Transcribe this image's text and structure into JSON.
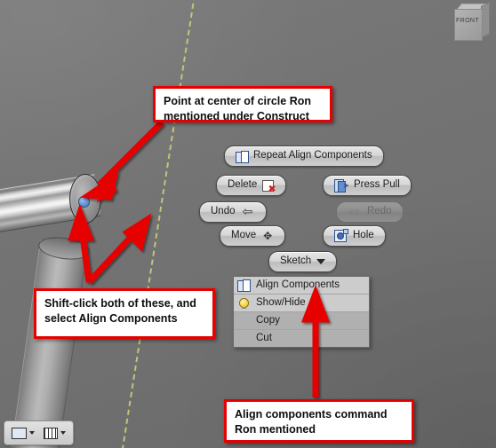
{
  "app": {
    "viewcube_label": "FRONT"
  },
  "marking_menu": {
    "buttons": [
      {
        "label": "Repeat Align Components",
        "icon": "align-components-icon",
        "enabled": true
      },
      {
        "label": "Delete",
        "icon": "delete-icon",
        "enabled": true
      },
      {
        "label": "Press Pull",
        "icon": "press-pull-icon",
        "enabled": true
      },
      {
        "label": "Undo",
        "icon": "undo-arrow-icon",
        "enabled": true
      },
      {
        "label": "Redo",
        "icon": "redo-arrow-icon",
        "enabled": false
      },
      {
        "label": "Move",
        "icon": "move-icon",
        "enabled": true
      },
      {
        "label": "Hole",
        "icon": "hole-icon",
        "enabled": true
      },
      {
        "label": "Sketch",
        "icon": "chevron-down-icon",
        "enabled": true
      }
    ]
  },
  "context_menu": {
    "items": [
      {
        "label": "Align Components",
        "icon": "align-components-icon",
        "highlighted": true
      },
      {
        "label": "Show/Hide",
        "icon": "lightbulb-icon",
        "highlighted": false
      },
      {
        "label": "Copy",
        "icon": "",
        "highlighted": false
      },
      {
        "label": "Cut",
        "icon": "",
        "highlighted": false
      }
    ]
  },
  "annotations": [
    {
      "id": "callout-point",
      "text": "Point at center of circle Ron mentioned under Construct"
    },
    {
      "id": "callout-shift",
      "text": "Shift-click both of these, and select Align Components"
    },
    {
      "id": "callout-cmd",
      "text": "Align components command Ron mentioned"
    }
  ],
  "status_bar": {
    "buttons": [
      {
        "name": "display-style-button",
        "icon": "display-style-icon"
      },
      {
        "name": "grid-settings-button",
        "icon": "grid-icon"
      }
    ]
  },
  "colors": {
    "annotation_border": "#e60000",
    "annotation_fill": "#ffffff",
    "viewport_background": "#737373",
    "axis_line": "#c8c87a",
    "center_point": "#5f8fd0"
  }
}
